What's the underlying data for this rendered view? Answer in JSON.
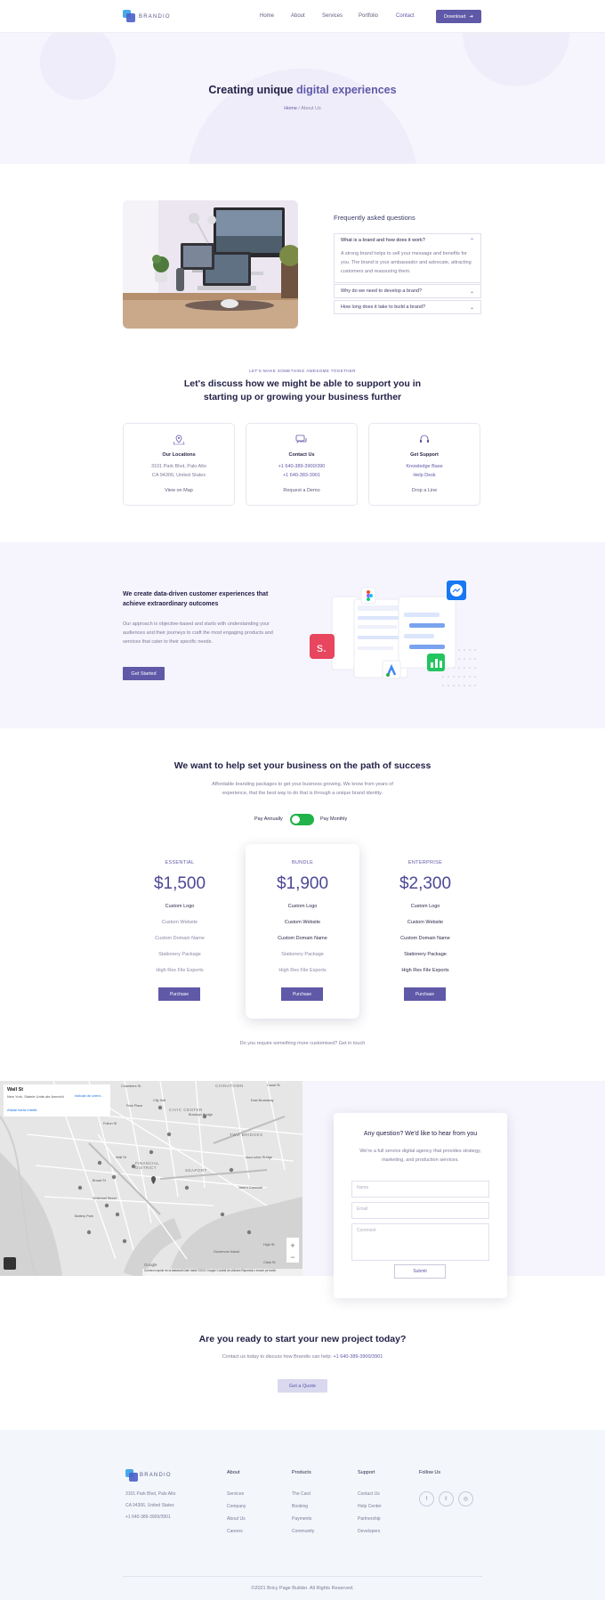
{
  "brand": "BRANDIO",
  "nav": {
    "items": [
      "Home",
      "About",
      "Services",
      "Portfolio",
      "Contact"
    ],
    "active": "Contact",
    "download": "Download"
  },
  "hero": {
    "title_a": "Creating unique ",
    "title_b": "digital experiences",
    "crumb_home": "Home",
    "crumb_sep": " / ",
    "crumb_page": "About Us"
  },
  "faq": {
    "heading": "Frequently asked questions",
    "items": [
      {
        "q": "What is a brand and how does it work?",
        "a": "A strong brand helps to sell your message and benefits for you. The brand is your ambassador and advocate, attracting customers and reassuring them.",
        "open": true
      },
      {
        "q": "Why do we need to develop a brand?",
        "open": false
      },
      {
        "q": "How long does it take to build a brand?",
        "open": false
      }
    ]
  },
  "discuss": {
    "eyebrow": "LET'S MAKE SOMETHING AWESOME TOGETHER",
    "title1": "Let's discuss how we might be able to support you in",
    "title2": "starting up or growing your business further",
    "cards": [
      {
        "title": "Our Locations",
        "l1": "3101 Park Blvd, Palo Alto",
        "l2": "CA 94306, United States",
        "link": "View on Map"
      },
      {
        "title": "Contact Us",
        "l1": "+1 640-389-3900/390",
        "l2": "+1 640-383-3901",
        "link": "Request a Demo"
      },
      {
        "title": "Get Support",
        "l1": "Knowledge Base",
        "l2": "Help Desk",
        "link": "Drop a Line"
      }
    ]
  },
  "data_driven": {
    "title": "We create data-driven customer experiences that achieve extraordinary outcomes",
    "body": "Our approach is objective-based and starts with understanding your audiences and their journeys to craft the most engaging products and services that cater to their specific needs.",
    "button": "Get Started"
  },
  "pricing": {
    "title": "We want to help set your business on the path of success",
    "sub1": "Affordable branding packages to get your business growing. We know from years of",
    "sub2": "experience, that the best way to do that is through a unique brand identity.",
    "annual": "Pay Annually",
    "monthly": "Pay Monthly",
    "plans": [
      {
        "name": "ESSENTIAL",
        "price": "$1,500",
        "features": [
          "Custom Logo",
          "Custom Website",
          "Custom Domain Name",
          "Stationery Package",
          "High Res File Exports"
        ],
        "included": [
          true,
          false,
          false,
          false,
          false
        ],
        "button": "Purchase"
      },
      {
        "name": "BUNDLE",
        "price": "$1,900",
        "features": [
          "Custom Logo",
          "Custom Website",
          "Custom Domain Name",
          "Stationery Package",
          "High Res File Exports"
        ],
        "included": [
          true,
          true,
          true,
          false,
          false
        ],
        "button": "Purchase"
      },
      {
        "name": "ENTERPRISE",
        "price": "$2,300",
        "features": [
          "Custom Logo",
          "Custom Website",
          "Custom Domain Name",
          "Stationery Package",
          "High Res File Exports"
        ],
        "included": [
          true,
          true,
          true,
          true,
          true
        ],
        "button": "Purchase"
      }
    ],
    "custom": "Do you require something more customised? Get in touch"
  },
  "map": {
    "title": "Wall St",
    "addr": "New York, Statele Unite ale Americii",
    "big": "Afișați harta mărită",
    "dir": "Indicații de orient...",
    "labels": [
      "CHINATOWN",
      "CIVIC CENTER",
      "TWO BRIDGES",
      "FINANCIAL DISTRICT",
      "SEAPORT",
      "Chambers St",
      "Canal St",
      "Park Place",
      "City Hall",
      "Fulton St",
      "Wall St",
      "Broad St",
      "Whitehall Street",
      "Brooklyn Bridge",
      "Manhattan Bridge",
      "Governors Island",
      "East Broadway",
      "Jane's Carousel",
      "Battery Park",
      "Clark St",
      "High St"
    ],
    "footer": "Comenzi rapide de la tastatură   Date hartă ©2021 Google   Condiții de utilizare   Raportați o eroare pe hartă",
    "google": "Google"
  },
  "contact": {
    "title": "Any question? We'd like to hear from you",
    "body": "We're a full service digital agency that provides strategy, marketing, and production services.",
    "name": "Name",
    "email": "Email",
    "comment": "Comment",
    "submit": "Submit"
  },
  "cta": {
    "title": "Are you ready to start your new project today?",
    "body_a": "Contact us today to discuss how Brandio can help: ",
    "phone": "+1 640-389-3900/3901",
    "button": "Get a Quote"
  },
  "footer": {
    "addr1": "3101 Park Blvd, Palo Alto",
    "addr2": "CA 94306, United States",
    "phone": "+1 640-389-3900/3901",
    "cols": [
      {
        "h": "About",
        "items": [
          "Services",
          "Company",
          "About Us",
          "Careers"
        ]
      },
      {
        "h": "Products",
        "items": [
          "The Card",
          "Booking",
          "Payments",
          "Community"
        ]
      },
      {
        "h": "Support",
        "items": [
          "Contact Us",
          "Help Center",
          "Partnership",
          "Developers"
        ]
      }
    ],
    "follow": "Follow Us",
    "copyright": "©2021 Bricy Page Builder. All Rights Reserved."
  },
  "colors": {
    "accent": "#5f59a8",
    "toggle": "#21b34a",
    "tint": "#f6f4fc"
  }
}
